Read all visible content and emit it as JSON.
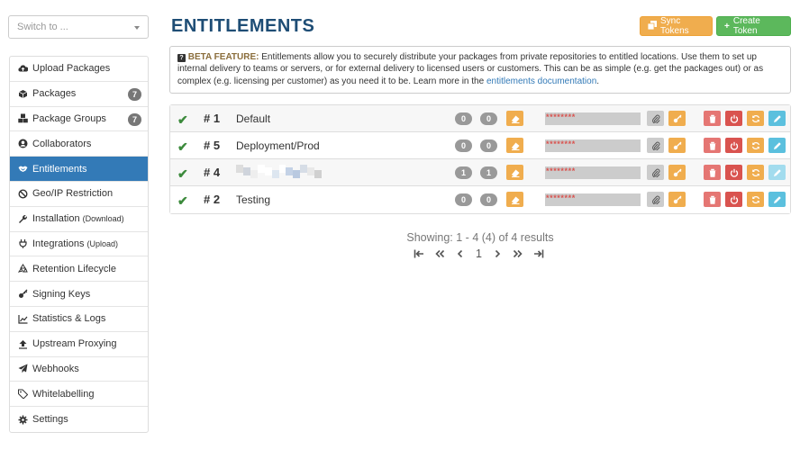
{
  "switcher": {
    "placeholder": "Switch to ..."
  },
  "sidebar": {
    "items": [
      {
        "label": "Upload Packages",
        "sub": "",
        "count": "",
        "icon": "cloud-upload-icon"
      },
      {
        "label": "Packages",
        "sub": "",
        "count": "7",
        "icon": "cube-icon"
      },
      {
        "label": "Package Groups",
        "sub": "",
        "count": "7",
        "icon": "cubes-icon"
      },
      {
        "label": "Collaborators",
        "sub": "",
        "count": "",
        "icon": "user-circle-icon"
      },
      {
        "label": "Entitlements",
        "sub": "",
        "count": "",
        "icon": "handshake-icon"
      },
      {
        "label": "Geo/IP Restriction",
        "sub": "",
        "count": "",
        "icon": "ban-icon"
      },
      {
        "label": "Installation",
        "sub": "(Download)",
        "count": "",
        "icon": "wrench-icon"
      },
      {
        "label": "Integrations",
        "sub": "(Upload)",
        "count": "",
        "icon": "plug-icon"
      },
      {
        "label": "Retention Lifecycle",
        "sub": "",
        "count": "",
        "icon": "recycle-icon"
      },
      {
        "label": "Signing Keys",
        "sub": "",
        "count": "",
        "icon": "key-icon"
      },
      {
        "label": "Statistics & Logs",
        "sub": "",
        "count": "",
        "icon": "chart-icon"
      },
      {
        "label": "Upstream Proxying",
        "sub": "",
        "count": "",
        "icon": "upload-icon"
      },
      {
        "label": "Webhooks",
        "sub": "",
        "count": "",
        "icon": "paper-plane-icon"
      },
      {
        "label": "Whitelabelling",
        "sub": "",
        "count": "",
        "icon": "tags-icon"
      },
      {
        "label": "Settings",
        "sub": "",
        "count": "",
        "icon": "gear-icon"
      }
    ]
  },
  "header": {
    "title": "ENTITLEMENTS",
    "sync_label": "Sync Tokens",
    "create_label": "Create Token"
  },
  "beta": {
    "feature_label": "BETA FEATURE:",
    "text": " Entitlements allow you to securely distribute your packages from private repositories to entitled locations. Use them to set up internal delivery to teams or servers, or for external delivery to licensed users or customers. This can be as simple (e.g. get the packages out) or as complex (e.g. licensing per customer) as you need it to be. Learn more in the ",
    "link_text": "entitlements documentation",
    "end": "."
  },
  "tokens": [
    {
      "number": "# 1",
      "name": "Default",
      "count_a": "0",
      "count_b": "0",
      "token_mask": "********",
      "disabled": false
    },
    {
      "number": "# 5",
      "name": "Deployment/Prod",
      "count_a": "0",
      "count_b": "0",
      "token_mask": "********",
      "disabled": false
    },
    {
      "number": "# 4",
      "name": "",
      "count_a": "1",
      "count_b": "1",
      "token_mask": "********",
      "disabled": true
    },
    {
      "number": "# 2",
      "name": "Testing",
      "count_a": "0",
      "count_b": "0",
      "token_mask": "********",
      "disabled": false
    }
  ],
  "pagination": {
    "showing": "Showing: 1 - 4 (4) of 4 results",
    "current_page": "1"
  },
  "colors": {
    "primary": "#337ab7",
    "title": "#1e4d75",
    "warning": "#f0ad4e",
    "success": "#5cb85c",
    "danger": "#d9534f",
    "info": "#5bc0de"
  }
}
